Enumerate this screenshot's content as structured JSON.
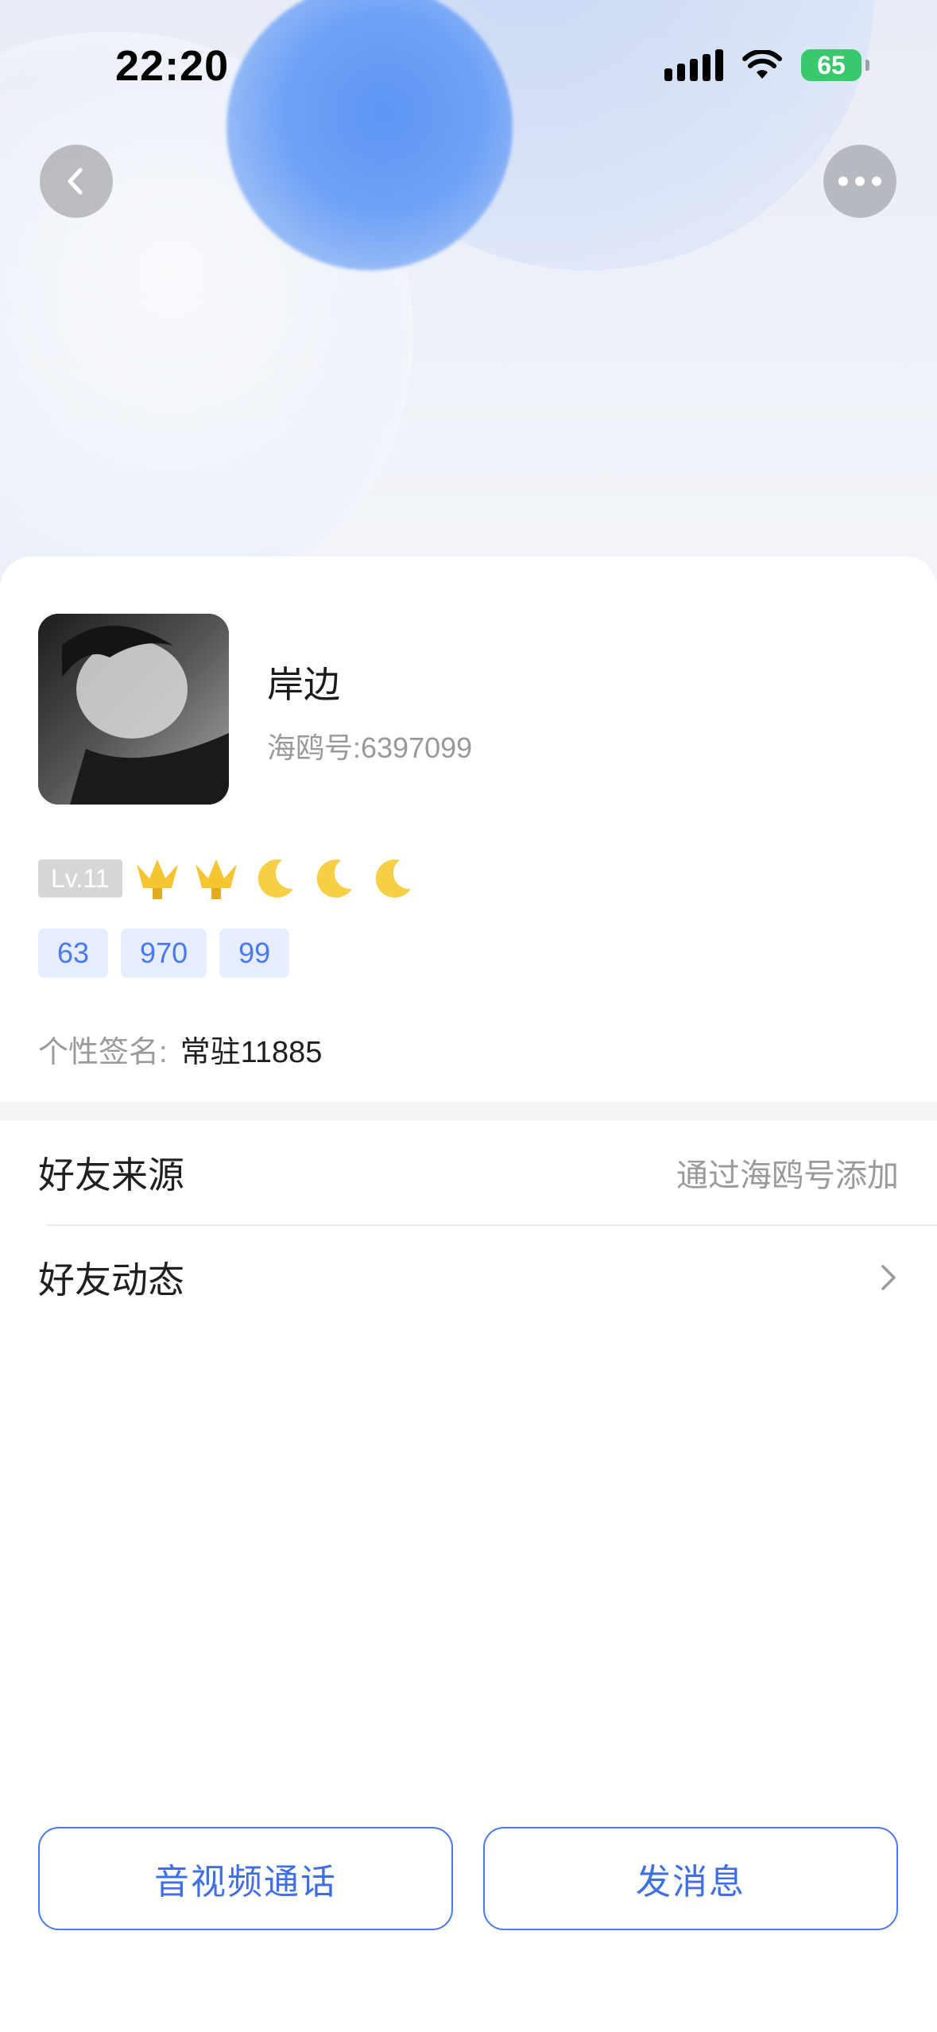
{
  "status_bar": {
    "time": "22:20",
    "battery": "65"
  },
  "profile": {
    "name": "岸边",
    "account_id": "海鸥号:6397099",
    "level": "Lv.11",
    "tags": [
      "63",
      "970",
      "99"
    ],
    "signature_label": "个性签名:",
    "signature_value": "常驻11885"
  },
  "rows": {
    "source_label": "好友来源",
    "source_value": "通过海鸥号添加",
    "moments_label": "好友动态"
  },
  "actions": {
    "call_label": "音视频通话",
    "message_label": "发消息"
  },
  "colors": {
    "accent": "#4a78f0",
    "tag_bg": "#e6edff",
    "battery": "#39c86b"
  },
  "icons": {
    "back": "chevron-left-icon",
    "more": "more-icon",
    "crowns": 2,
    "moons": 3
  }
}
